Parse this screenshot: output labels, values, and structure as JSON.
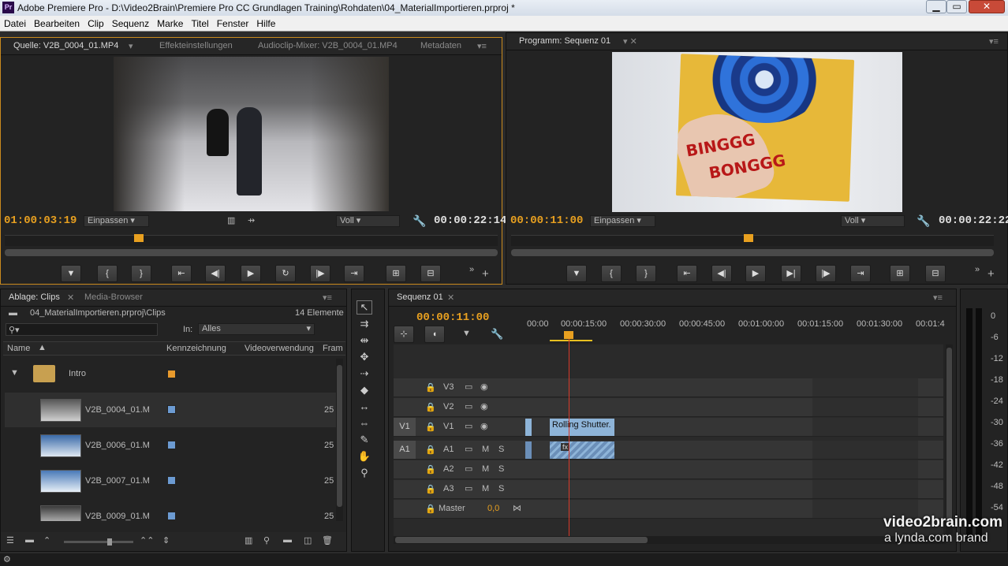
{
  "window": {
    "title": "Adobe Premiere Pro - D:\\Video2Brain\\Premiere Pro CC Grundlagen Training\\Rohdaten\\04_MaterialImportieren.prproj *",
    "min": "▁",
    "max": "▭",
    "close": "✕"
  },
  "menu": [
    "Datei",
    "Bearbeiten",
    "Clip",
    "Sequenz",
    "Marke",
    "Titel",
    "Fenster",
    "Hilfe"
  ],
  "source": {
    "tabs": [
      "Quelle: V2B_0004_01.MP4",
      "Effekteinstellungen",
      "Audioclip-Mixer: V2B_0004_01.MP4",
      "Metadaten"
    ],
    "timecode_in": "01:00:03:19",
    "fit": "Einpassen",
    "quality": "Voll",
    "duration": "00:00:22:14",
    "playhead": 0.24
  },
  "program": {
    "tab": "Programm: Sequenz 01",
    "timecode_in": "00:00:11:00",
    "fit": "Einpassen",
    "quality": "Voll",
    "duration": "00:00:22:22",
    "playhead": 0.49,
    "frame_text_1": "BINGGG",
    "frame_text_2": "BONGGG"
  },
  "project": {
    "tabs": [
      "Ablage: Clips",
      "Media-Browser"
    ],
    "path": "04_MaterialImportieren.prproj\\Clips",
    "count": "14 Elemente",
    "in_label": "In:",
    "in_value": "Alles",
    "columns": [
      "Name",
      "Kennzeichnung",
      "Videoverwendung",
      "Fram"
    ],
    "folder": "Intro",
    "items": [
      {
        "name": "V2B_0004_01.M",
        "uses": "25"
      },
      {
        "name": "V2B_0006_01.M",
        "uses": "25"
      },
      {
        "name": "V2B_0007_01.M",
        "uses": "25"
      },
      {
        "name": "V2B_0009_01.M",
        "uses": "25"
      }
    ]
  },
  "timeline": {
    "tab": "Sequenz 01",
    "timecode": "00:00:11:00",
    "ruler": [
      "00:00",
      "00:00:15:00",
      "00:00:30:00",
      "00:00:45:00",
      "00:01:00:00",
      "00:01:15:00",
      "00:01:30:00",
      "00:01:4"
    ],
    "video_tracks": [
      "V3",
      "V2",
      "V1"
    ],
    "audio_tracks": [
      "A1",
      "A2",
      "A3"
    ],
    "src_v": "V1",
    "src_a": "A1",
    "mute": "M",
    "solo": "S",
    "master": "Master",
    "master_val": "0,0",
    "clip_v": "Rolling Shutter.",
    "clip_a": "fx"
  },
  "meters": {
    "scale": [
      "0",
      "-6",
      "-12",
      "-18",
      "-24",
      "-30",
      "-36",
      "-42",
      "-48",
      "-54"
    ]
  },
  "watermark": {
    "brand": "video2brain.com",
    "sub": "a lynda.com brand"
  },
  "colors": {
    "accent": "#e8a020",
    "clip_video": "#8eb4d8",
    "clip_audio": "#6b8fb8",
    "label_folder": "#e89a2c",
    "label_clip": "#6c9bd2"
  }
}
